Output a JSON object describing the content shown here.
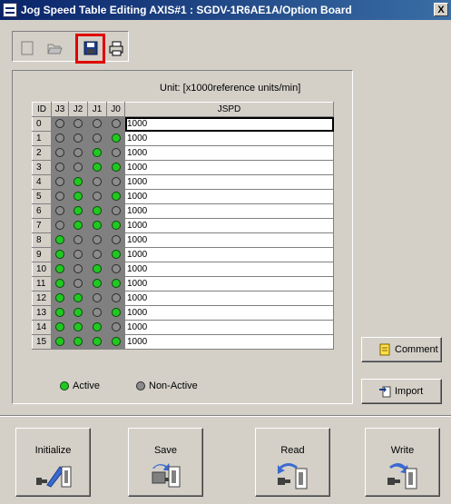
{
  "window": {
    "title": "Jog Speed Table Editing AXIS#1 : SGDV-1R6AE1A/Option Board",
    "close_label": "X"
  },
  "toolbar": {
    "new": "new-icon",
    "open": "open-folder-icon",
    "save": "save-disk-icon",
    "print": "printer-icon"
  },
  "table": {
    "unit_label": "Unit:  [x1000reference units/min]",
    "headers": [
      "ID",
      "J3",
      "J2",
      "J1",
      "J0",
      "JSPD"
    ],
    "rows": [
      {
        "id": "0",
        "bits": [
          0,
          0,
          0,
          0
        ],
        "jspd": "1000"
      },
      {
        "id": "1",
        "bits": [
          0,
          0,
          0,
          1
        ],
        "jspd": "1000"
      },
      {
        "id": "2",
        "bits": [
          0,
          0,
          1,
          0
        ],
        "jspd": "1000"
      },
      {
        "id": "3",
        "bits": [
          0,
          0,
          1,
          1
        ],
        "jspd": "1000"
      },
      {
        "id": "4",
        "bits": [
          0,
          1,
          0,
          0
        ],
        "jspd": "1000"
      },
      {
        "id": "5",
        "bits": [
          0,
          1,
          0,
          1
        ],
        "jspd": "1000"
      },
      {
        "id": "6",
        "bits": [
          0,
          1,
          1,
          0
        ],
        "jspd": "1000"
      },
      {
        "id": "7",
        "bits": [
          0,
          1,
          1,
          1
        ],
        "jspd": "1000"
      },
      {
        "id": "8",
        "bits": [
          1,
          0,
          0,
          0
        ],
        "jspd": "1000"
      },
      {
        "id": "9",
        "bits": [
          1,
          0,
          0,
          1
        ],
        "jspd": "1000"
      },
      {
        "id": "10",
        "bits": [
          1,
          0,
          1,
          0
        ],
        "jspd": "1000"
      },
      {
        "id": "11",
        "bits": [
          1,
          0,
          1,
          1
        ],
        "jspd": "1000"
      },
      {
        "id": "12",
        "bits": [
          1,
          1,
          0,
          0
        ],
        "jspd": "1000"
      },
      {
        "id": "13",
        "bits": [
          1,
          1,
          0,
          1
        ],
        "jspd": "1000"
      },
      {
        "id": "14",
        "bits": [
          1,
          1,
          1,
          0
        ],
        "jspd": "1000"
      },
      {
        "id": "15",
        "bits": [
          1,
          1,
          1,
          1
        ],
        "jspd": "1000"
      }
    ]
  },
  "legend": {
    "active": "Active",
    "inactive": "Non-Active"
  },
  "side_buttons": {
    "comment": "Comment",
    "import": "Import"
  },
  "bottom_buttons": {
    "initialize": "Initialize",
    "save": "Save",
    "read": "Read",
    "write": "Write"
  },
  "colors": {
    "active_led": "#22c822",
    "inactive_led": "#8c8c8c",
    "highlight": "#e00000"
  }
}
